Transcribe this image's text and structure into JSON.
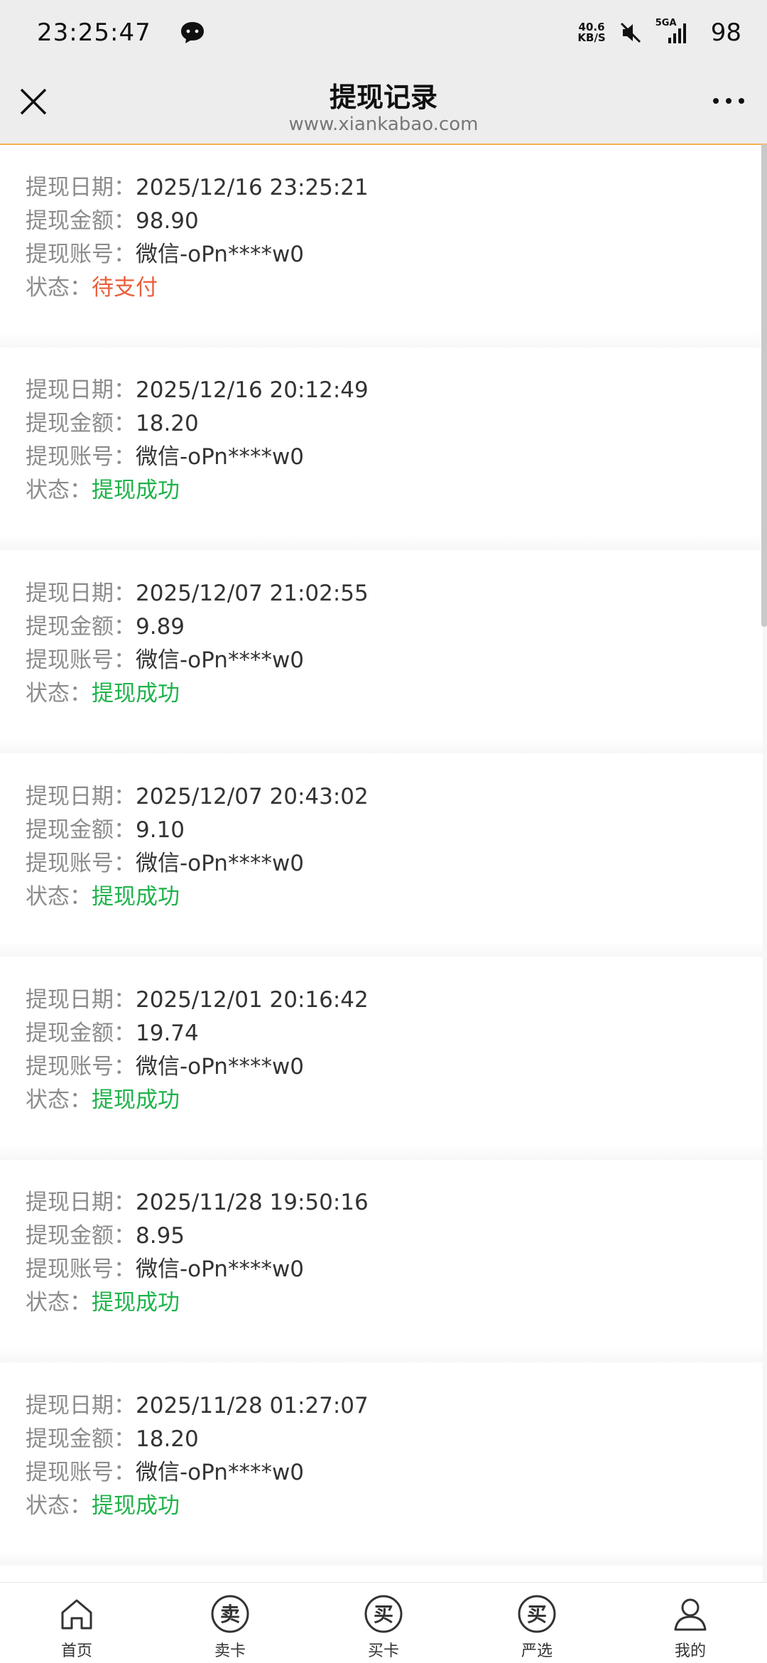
{
  "status_bar": {
    "time": "23:25:47",
    "net_speed_value": "40.6",
    "net_speed_unit": "KB/S",
    "network": "5GA",
    "battery": "98"
  },
  "header": {
    "title": "提现记录",
    "url": "www.xiankabao.com"
  },
  "labels": {
    "date": "提现日期：",
    "amount": "提现金额：",
    "account": "提现账号：",
    "status": "状态："
  },
  "records": [
    {
      "date": "2025/12/16 23:25:21",
      "amount": "98.90",
      "account": "微信-oPn****w0",
      "status": "待支付",
      "status_type": "pending"
    },
    {
      "date": "2025/12/16 20:12:49",
      "amount": "18.20",
      "account": "微信-oPn****w0",
      "status": "提现成功",
      "status_type": "success"
    },
    {
      "date": "2025/12/07 21:02:55",
      "amount": "9.89",
      "account": "微信-oPn****w0",
      "status": "提现成功",
      "status_type": "success"
    },
    {
      "date": "2025/12/07 20:43:02",
      "amount": "9.10",
      "account": "微信-oPn****w0",
      "status": "提现成功",
      "status_type": "success"
    },
    {
      "date": "2025/12/01 20:16:42",
      "amount": "19.74",
      "account": "微信-oPn****w0",
      "status": "提现成功",
      "status_type": "success"
    },
    {
      "date": "2025/11/28 19:50:16",
      "amount": "8.95",
      "account": "微信-oPn****w0",
      "status": "提现成功",
      "status_type": "success"
    },
    {
      "date": "2025/11/28 01:27:07",
      "amount": "18.20",
      "account": "微信-oPn****w0",
      "status": "提现成功",
      "status_type": "success"
    }
  ],
  "tabs": [
    {
      "label": "首页",
      "icon": "home-icon"
    },
    {
      "label": "卖卡",
      "icon": "sell-icon",
      "glyph": "卖"
    },
    {
      "label": "买卡",
      "icon": "buy-icon",
      "glyph": "买"
    },
    {
      "label": "严选",
      "icon": "select-icon",
      "glyph": "买"
    },
    {
      "label": "我的",
      "icon": "profile-icon"
    }
  ],
  "colors": {
    "pending": "#e9603b",
    "success": "#1fb34a",
    "accent": "#f3b24c"
  }
}
